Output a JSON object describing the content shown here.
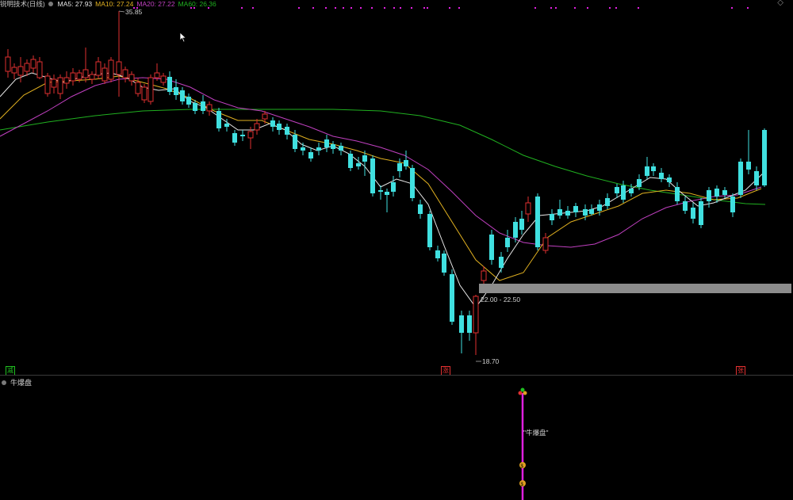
{
  "header": {
    "stock_name": "锐明技术(日线)",
    "ma": [
      {
        "label": "MA5: 27.93",
        "color": "#e8e8e8"
      },
      {
        "label": "MA10: 27.24",
        "color": "#e0b020"
      },
      {
        "label": "MA20: 27.22",
        "color": "#c040c0"
      },
      {
        "label": "MA60: 26.36",
        "color": "#20b020"
      }
    ]
  },
  "annotations": {
    "high": "35.85",
    "low": "18.70",
    "range": "22.00 - 22.50"
  },
  "bottom_tags": [
    {
      "text": "减",
      "color": "#20c020"
    },
    {
      "text": "涨",
      "color": "#e03030"
    },
    {
      "text": "张",
      "color": "#e03030"
    }
  ],
  "sub_panel": {
    "title": "牛爆盘",
    "signal_label": "\"牛爆盘\""
  },
  "colors": {
    "up": "#e03030",
    "down": "#40e0e0",
    "ma5": "#e8e8e8",
    "ma10": "#e0b020",
    "ma20": "#c040c0",
    "ma60": "#20b020",
    "zone": "#8c8c8c",
    "signal": "#e020e0"
  },
  "icons": {
    "cursor": "arrow-cursor-icon",
    "settings": "circle-icon",
    "expand": "diamond-icon"
  }
}
